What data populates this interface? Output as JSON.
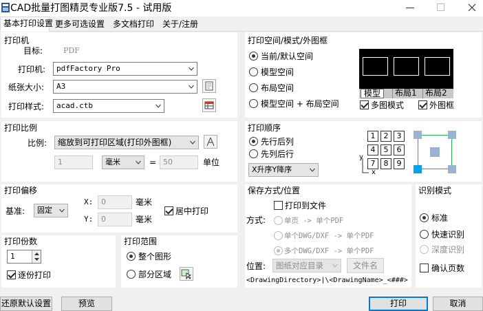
{
  "window": {
    "title": "CAD批量打图精灵专业版7.5 - 试用版",
    "controls": [
      "minimize-icon",
      "maximize-icon",
      "close-icon"
    ]
  },
  "tabs": [
    {
      "label": "基本打印设置",
      "active": true
    },
    {
      "label": "更多可选设置",
      "active": false
    },
    {
      "label": "多文档打印",
      "active": false
    },
    {
      "label": "关于/注册",
      "active": false
    }
  ],
  "printer": {
    "title": "打印机",
    "target_label": "目标:",
    "target_value": "PDF",
    "printer_label": "打印机:",
    "printer_value": "pdfFactory Pro",
    "paper_label": "纸张大小:",
    "paper_value": "A3",
    "style_label": "打印样式:",
    "style_value": "acad.ctb"
  },
  "space": {
    "title": "打印空间/模式/外图框",
    "options": [
      "当前/默认空间",
      "模型空间",
      "布局空间",
      "模型空间 + 布局空间"
    ],
    "selected": 0,
    "preview_tabs": [
      "模型",
      "布局1",
      "布局2"
    ],
    "multi_mode_label": "多图模式",
    "multi_mode_checked": true,
    "outer_frame_label": "外图框",
    "outer_frame_checked": true
  },
  "scale": {
    "title": "打印比例",
    "ratio_label": "比例:",
    "ratio_value": "缩放到可打印区域(打印外图框)",
    "value1": "1",
    "unit_value": "毫米",
    "equals": "=",
    "value2": "50",
    "unit_label": "单位"
  },
  "order": {
    "title": "打印顺序",
    "options": [
      "先行后列",
      "先列后行"
    ],
    "selected": 0,
    "sort_value": "X升序Y降序",
    "grid": [
      "1",
      "2",
      "3",
      "4",
      "5",
      "6",
      "7",
      "8",
      "9"
    ],
    "axis_y": "y",
    "axis_x": "x"
  },
  "offset": {
    "title": "打印偏移",
    "base_label": "基准:",
    "base_value": "固定",
    "x_label": "X:",
    "x_value": "0",
    "x_unit": "毫米",
    "y_label": "Y:",
    "y_value": "0",
    "y_unit": "毫米",
    "center_label": "居中打印",
    "center_checked": true
  },
  "save": {
    "title": "保存方式/位置",
    "to_file_label": "打印到文件",
    "to_file_checked": false,
    "method_label": "方式:",
    "methods": [
      "单页 -> 单个PDF",
      "单个DWG/DXF -> 单个PDF",
      "多个DWG/DXF -> 单个PDF"
    ],
    "method_selected": 2,
    "location_label": "位置:",
    "location_value": "图纸对应目录",
    "filename_button": "文件名",
    "path_pattern": "<DrawingDirectory>|\\<DrawingName>_<###>"
  },
  "recognition": {
    "title": "识别模式",
    "options": [
      "标准",
      "快速识别",
      "深度识别"
    ],
    "selected": 0,
    "confirm_pages_label": "确认页数",
    "confirm_pages_checked": false
  },
  "copies": {
    "title": "打印份数",
    "value": "1",
    "collate_label": "逐份打印",
    "collate_checked": true
  },
  "range": {
    "title": "打印范围",
    "options": [
      "整个图形",
      "部分区域"
    ],
    "selected": 0
  },
  "footer": {
    "restore_button": "还原默认设置",
    "preview_button": "预览",
    "print_button": "打印",
    "cancel_button": "取消"
  },
  "colors": {
    "accent": "#0078d7",
    "preview_bg": "#000000",
    "order_highlight": "#00a2e8",
    "order_frame": "#22b14c",
    "order_corner": "#99b4d1"
  }
}
